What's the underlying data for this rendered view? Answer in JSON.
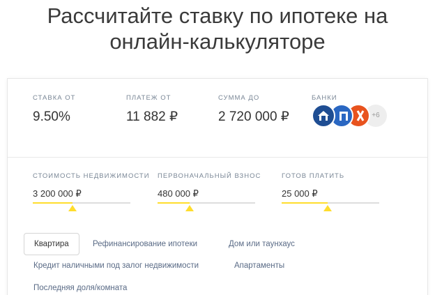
{
  "heading": {
    "line1": "Рассчитайте ставку по ипотеке на",
    "line2": "онлайн-калькуляторе"
  },
  "stats": {
    "rate": {
      "label": "СТАВКА ОТ",
      "value": "9.50%"
    },
    "payment": {
      "label": "ПЛАТЕЖ ОТ",
      "value": "11 882 ₽"
    },
    "amount": {
      "label": "СУММА ДО",
      "value": "2 720 000 ₽"
    },
    "banks": {
      "label": "БАНКИ",
      "more": "+6",
      "icons": [
        "bank-logo-icon",
        "bank-logo-icon",
        "bank-logo-icon"
      ]
    }
  },
  "sliders": {
    "property_cost": {
      "label": "СТОИМОСТЬ НЕДВИЖИМОСТИ",
      "value": "3 200 000 ₽",
      "level": 0.41
    },
    "down_payment": {
      "label": "ПЕРВОНАЧАЛЬНЫЙ ВЗНОС",
      "value": "480 000 ₽",
      "level": 0.33
    },
    "monthly": {
      "label": "ГОТОВ ПЛАТИТЬ",
      "value": "25 000 ₽",
      "level": 0.47
    }
  },
  "tabs": {
    "apartment": "Квартира",
    "refinancing": "Рефинансирование ипотеки",
    "house": "Дом или таунхаус",
    "cash_loan": "Кредит наличными под залог недвижимости",
    "apartments": "Апартаменты",
    "share": "Последняя доля/комната"
  },
  "colors": {
    "accent": "#ffdd2d",
    "label": "#7a8796",
    "bank1": "#1f4e93",
    "bank2": "#2a67c2",
    "bank3": "#e8531e"
  }
}
